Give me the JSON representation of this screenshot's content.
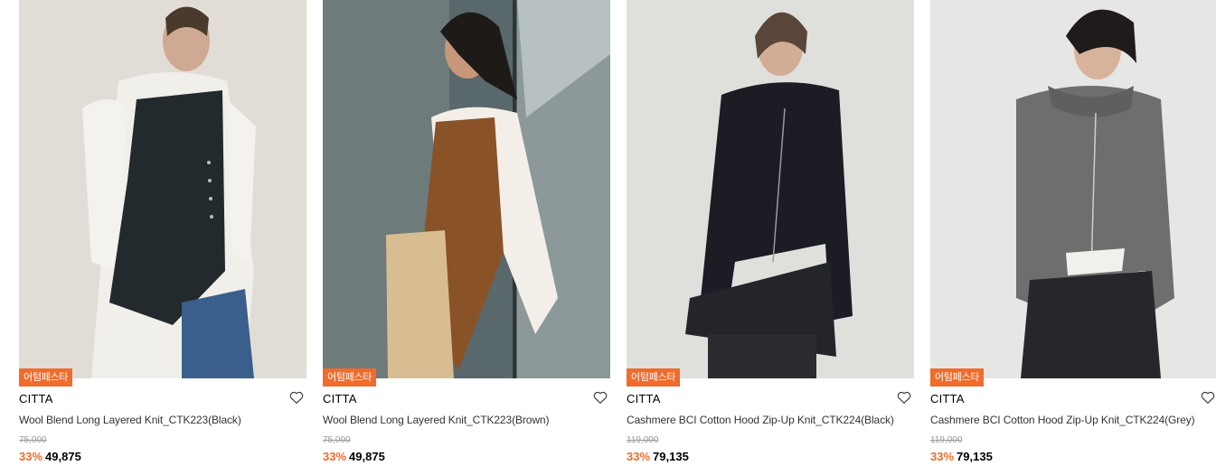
{
  "products": [
    {
      "badge": "어텀페스타",
      "brand": "CITTA",
      "name": "Wool Blend Long Layered Knit_CTK223(Black)",
      "original_price": "75,000",
      "discount": "33%",
      "price": "49,875",
      "image_alt": "Wool Blend Long Layered Knit_CTK223(Black)"
    },
    {
      "badge": "어텀페스타",
      "brand": "CITTA",
      "name": "Wool Blend Long Layered Knit_CTK223(Brown)",
      "original_price": "75,000",
      "discount": "33%",
      "price": "49,875",
      "image_alt": "Wool Blend Long Layered Knit_CTK223(Brown)"
    },
    {
      "badge": "어텀페스타",
      "brand": "CITTA",
      "name": "Cashmere BCI Cotton Hood Zip-Up Knit_CTK224(Black)",
      "original_price": "119,000",
      "discount": "33%",
      "price": "79,135",
      "image_alt": "Cashmere BCI Cotton Hood Zip-Up Knit_CTK224(Black)"
    },
    {
      "badge": "어텀페스타",
      "brand": "CITTA",
      "name": "Cashmere BCI Cotton Hood Zip-Up Knit_CTK224(Grey)",
      "original_price": "119,000",
      "discount": "33%",
      "price": "79,135",
      "image_alt": "Cashmere BCI Cotton Hood Zip-Up Knit_CTK224(Grey)"
    }
  ],
  "icons": {
    "wishlist": "heart-icon"
  },
  "colors": {
    "accent": "#f16b2b",
    "original_price": "#999999",
    "text": "#000000"
  }
}
